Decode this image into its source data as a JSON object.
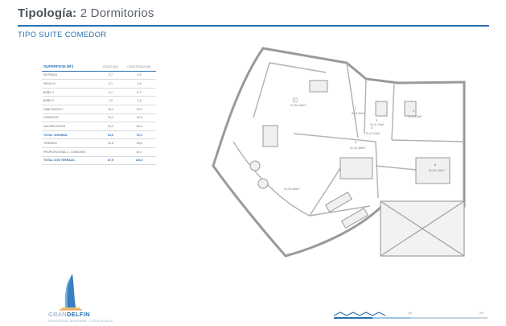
{
  "header": {
    "title_bold": "Tipología:",
    "title_rest": "2 Dormitorios",
    "subtitle": "TIPO SUITE COMEDOR"
  },
  "table": {
    "heading": "SUPERFICIE (M²)",
    "col_useful": "ÚTILES (M²)",
    "col_built": "CONSTRUIDA (M²)",
    "rows": [
      {
        "label": "ENTRADA",
        "useful": "3,7",
        "built": "4,5"
      },
      {
        "label": "PASILLO",
        "useful": "2,1",
        "built": "2,6"
      },
      {
        "label": "BAÑO 1",
        "useful": "4,7",
        "built": "5,7"
      },
      {
        "label": "BAÑO 2",
        "useful": "2,5",
        "built": "3,1"
      },
      {
        "label": "HABITACIÓN 1",
        "useful": "15,3",
        "built": "18,9"
      },
      {
        "label": "COMEDOR",
        "useful": "12,1",
        "built": "14,8"
      },
      {
        "label": "SALÓN/COCINA",
        "useful": "24,3",
        "built": "26,6"
      }
    ],
    "total_living": {
      "label": "TOTAL VIVIENDA",
      "useful": "64,9",
      "built": "76,2"
    },
    "terrace": {
      "label": "TERRAZA",
      "useful": "23,6",
      "built": "29,6"
    },
    "common": {
      "label": "PROPORCIONAL Z. COMUNES",
      "useful": "",
      "built": "30,1"
    },
    "total_with_terrace": {
      "label": "TOTAL CON TERRAZA",
      "useful": "87,9",
      "built": "136,0"
    }
  },
  "plan": {
    "room_labels": [
      "1",
      "2",
      "3",
      "4",
      "5",
      "6",
      "7",
      "8"
    ],
    "room_areas": [
      "S=24,30m²",
      "S=3,80m²",
      "S=4,70m²",
      "S=3,10m²",
      "S=2,10m²",
      "S=12,60m²",
      "S=22,40m²",
      "S=23,60m²"
    ]
  },
  "brand": {
    "name_part1": "GRAN",
    "name_part2": "DELFIN",
    "tagline": "RESIDENCIAL BENIDORM · COSTA BLANCA"
  },
  "scale": {
    "mid": "2m",
    "end": "5m"
  },
  "colors": {
    "accent": "#2a6fb0",
    "rule": "#2a6fb0",
    "wall": "#9a9a9a"
  }
}
